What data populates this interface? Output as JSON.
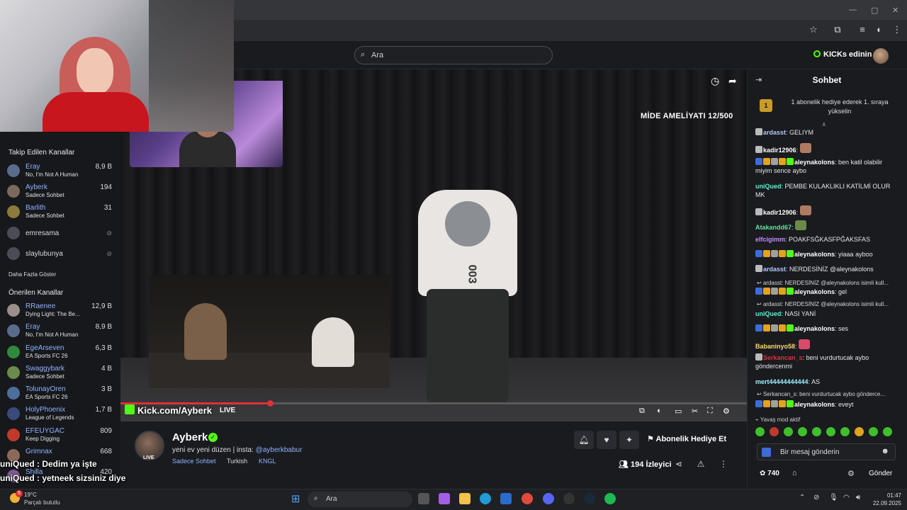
{
  "search": {
    "placeholder": "Ara"
  },
  "header": {
    "kicks_label": "KICKs edinin"
  },
  "sidebar": {
    "followed_title": "Takip Edilen Kanallar",
    "followed": [
      {
        "name": "Eray",
        "category": "No, I'm Not A Human",
        "viewers": "8,9 B"
      },
      {
        "name": "Ayberk",
        "category": "Sadece Sohbet",
        "viewers": "194"
      },
      {
        "name": "Barlith",
        "category": "Sadece Sohbet",
        "viewers": "31"
      },
      {
        "name": "emresama",
        "category": "",
        "viewers": ""
      },
      {
        "name": "slaylubunya",
        "category": "",
        "viewers": ""
      }
    ],
    "show_more": "Daha Fazla Göster",
    "recommended_title": "Önerilen Kanallar",
    "recommended": [
      {
        "name": "RRaenee",
        "category": "Dying Light: The Be...",
        "viewers": "12,9 B"
      },
      {
        "name": "Eray",
        "category": "No, I'm Not A Human",
        "viewers": "8,9 B"
      },
      {
        "name": "EgeArseven",
        "category": "EA Sports FC 26",
        "viewers": "6,3 B"
      },
      {
        "name": "Swaggybark",
        "category": "Sadece Sohbet",
        "viewers": "4 B"
      },
      {
        "name": "TolunayOren",
        "category": "EA Sports FC 26",
        "viewers": "3 B"
      },
      {
        "name": "HolyPhoenix",
        "category": "League of Legends",
        "viewers": "1,7 B"
      },
      {
        "name": "EFEUYGAC",
        "category": "Keep Digging",
        "viewers": "809"
      },
      {
        "name": "Grimnax",
        "category": "",
        "viewers": "668"
      },
      {
        "name": "Shilla",
        "category": "",
        "viewers": "420"
      }
    ]
  },
  "player": {
    "overlay_title": "MİDE AMELİYATI 12/500",
    "watermark": "Kick.com/Ayberk",
    "live_label": "LIVE"
  },
  "channel": {
    "name": "Ayberk",
    "live_badge": "LIVE",
    "title_prefix": "yeni ev yeni düzen | insta: ",
    "insta": "@ayberkbabur",
    "category": "Sadece Sohbet",
    "language": "Turkish",
    "tag": "KNGL",
    "gift_sub_label": "Abonelik Hediye Et",
    "viewers": "194 İzleyici"
  },
  "chat": {
    "title": "Sohbet",
    "gift_banner": "1 abonelik hediye ederek 1. sıraya yükselin",
    "gift_badge": "1",
    "messages": [
      {
        "user": "ardasst",
        "text": "GELIYM"
      },
      {
        "user": "kadir12906",
        "text": ""
      },
      {
        "user": "aleynakolons",
        "text": "ben katil olabilir miyim sence aybo"
      },
      {
        "user": "uniQued",
        "text": "PEMBE KULAKLIKLI KATİLMİ OLUR MK"
      },
      {
        "user": "kadir12906",
        "text": ""
      },
      {
        "user": "Atakandd67",
        "text": ""
      },
      {
        "user": "elfcigimm",
        "text": "POAKFSĞKASFPĞAKSFAS"
      },
      {
        "user": "aleynakolons",
        "text": "yiaaa ayboo"
      },
      {
        "user": "ardasst",
        "text": "NERDESİNİZ @aleynakolons"
      },
      {
        "reply": "ardasst: NERDESİNİZ @aleynakolons isimli kull..."
      },
      {
        "user": "aleynakolons",
        "text": "gel"
      },
      {
        "reply": "ardasst: NERDESİNİZ @aleynakolons isimli kull..."
      },
      {
        "user": "uniQued",
        "text": "NASI YANİ"
      },
      {
        "user": "aleynakolons",
        "text": "ses"
      },
      {
        "user": "Babaninyo58",
        "text": ""
      },
      {
        "user": "Serkancan_s",
        "text": "beni vurdurtucak aybo göndercenmi"
      },
      {
        "user": "mert44444444444",
        "text": "AS"
      },
      {
        "reply": "Serkancan_s: beni vurdurtucak aybo gönderce..."
      },
      {
        "user": "aleynakolons",
        "text": "eveyt"
      }
    ],
    "slow_mode": "Yavaş mod aktif",
    "input_placeholder": "Bir mesaj gönderin",
    "points": "740",
    "send_label": "Gönder"
  },
  "overlay_chat": [
    "uniQued : Dedim ya işte",
    "uniQued : yetneek sizsiniz diye"
  ],
  "taskbar": {
    "temperature": "19°C",
    "weather": "Parçalı bulutlu",
    "notif_count": "5",
    "search_placeholder": "Ara",
    "time": "01:47",
    "date": "22.09.2025"
  },
  "colors": {
    "brand_green": "#53fc18",
    "username_blue": "#8fb3ff",
    "accent_red": "#e0303a"
  }
}
